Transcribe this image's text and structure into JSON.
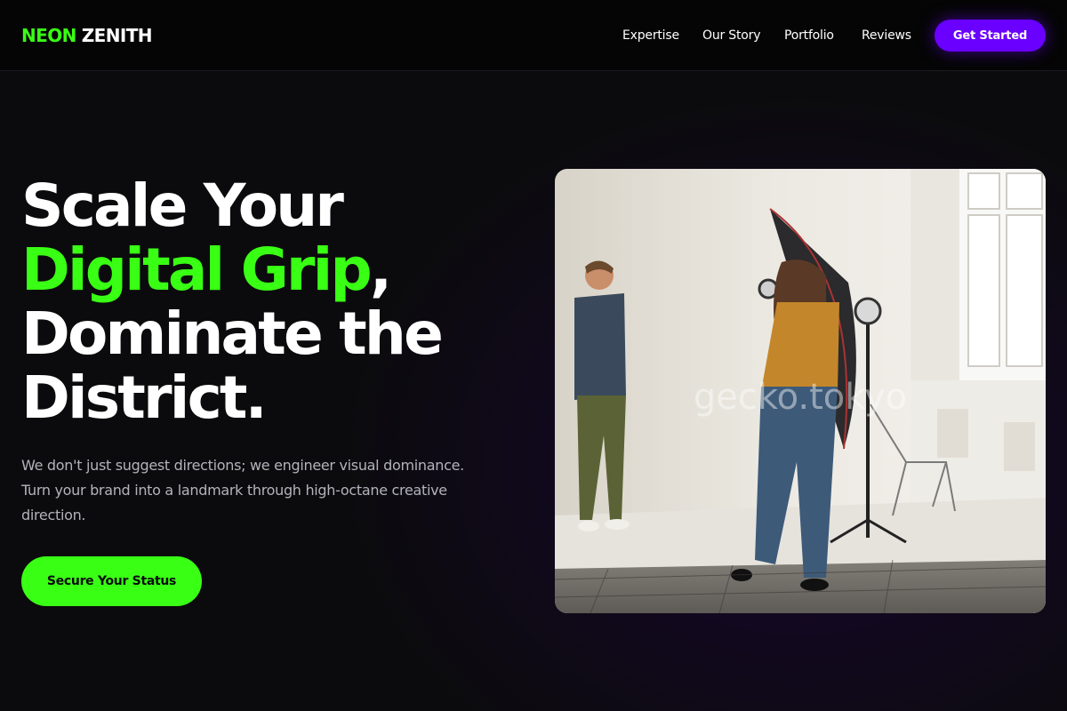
{
  "brand": {
    "name_part1": "NEON",
    "name_part2": "ZENITH",
    "accent_color": "#39ff14"
  },
  "nav": {
    "links": [
      {
        "label": "Expertise"
      },
      {
        "label": "Our Story"
      },
      {
        "label": "Portfolio"
      },
      {
        "label": "Reviews"
      }
    ],
    "cta_label": "Get Started",
    "cta_color": "#6a00ff"
  },
  "hero": {
    "headline_line1": "Scale Your",
    "headline_accent": "Digital Grip",
    "headline_comma": ",",
    "headline_line3": "Dominate the",
    "headline_line4": "District.",
    "subtext": "We don't just suggest directions; we engineer visual dominance. Turn your brand into a landmark through high-octane creative direction.",
    "cta_label": "Secure Your Status",
    "image_watermark": "gecko.tokyo"
  }
}
